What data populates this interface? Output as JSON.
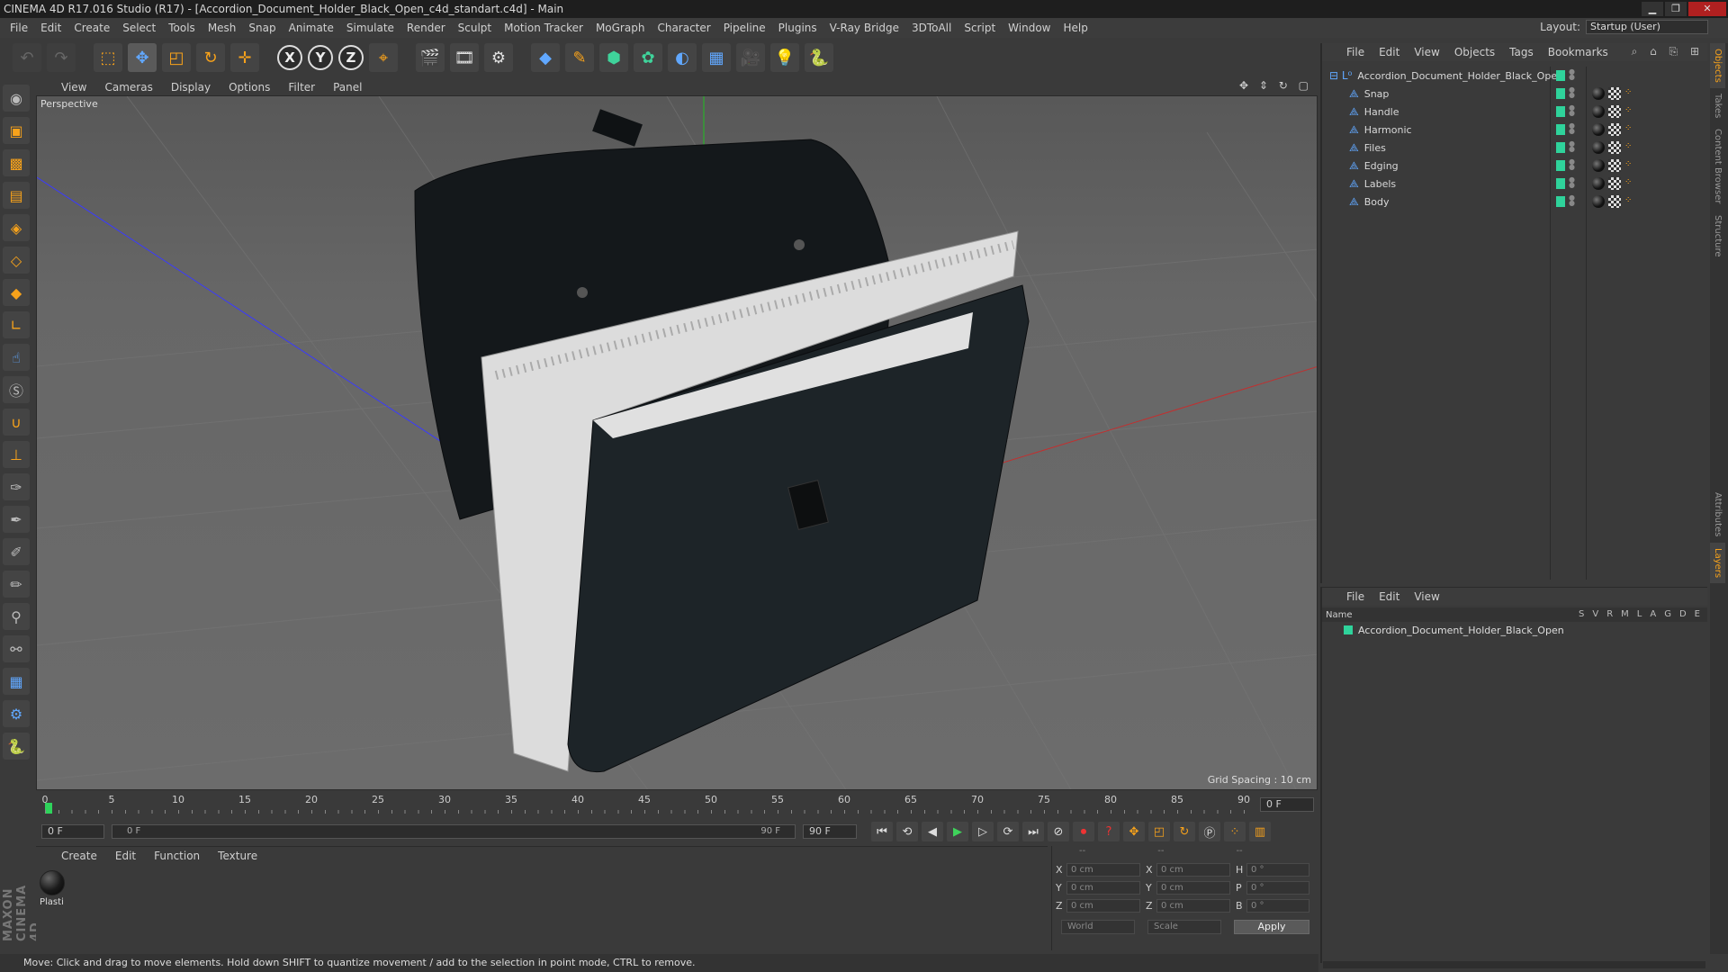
{
  "window": {
    "title": "CINEMA 4D R17.016 Studio (R17) - [Accordion_Document_Holder_Black_Open_c4d_standart.c4d] - Main",
    "minimize": "▁",
    "maximize": "❐",
    "close": "✕"
  },
  "menu": [
    "File",
    "Edit",
    "Create",
    "Select",
    "Tools",
    "Mesh",
    "Snap",
    "Animate",
    "Simulate",
    "Render",
    "Sculpt",
    "Motion Tracker",
    "MoGraph",
    "Character",
    "Pipeline",
    "Plugins",
    "V-Ray Bridge",
    "3DToAll",
    "Script",
    "Window",
    "Help"
  ],
  "layout": {
    "label": "Layout:",
    "value": "Startup (User)"
  },
  "viewport": {
    "menu": [
      "View",
      "Cameras",
      "Display",
      "Options",
      "Filter",
      "Panel"
    ],
    "label": "Perspective",
    "grid_spacing": "Grid Spacing : 10 cm",
    "nav_icons": "✥ ⇕ ↻ ▢"
  },
  "timeline": {
    "ticks": [
      "0",
      "5",
      "10",
      "15",
      "20",
      "25",
      "30",
      "35",
      "40",
      "45",
      "50",
      "55",
      "60",
      "65",
      "70",
      "75",
      "80",
      "85",
      "90"
    ],
    "current_frame": "0 F",
    "start_field": "0 F",
    "slider_start": "0 F",
    "slider_end": "90 F",
    "end_field": "90 F"
  },
  "materials": {
    "menu": [
      "Create",
      "Edit",
      "Function",
      "Texture"
    ],
    "items": [
      {
        "name": "Plasti"
      }
    ]
  },
  "coords": {
    "headers": [
      "--",
      "--",
      "--"
    ],
    "rows": [
      {
        "a": "X",
        "av": "0 cm",
        "b": "X",
        "bv": "0 cm",
        "c": "H",
        "cv": "0 °"
      },
      {
        "a": "Y",
        "av": "0 cm",
        "b": "Y",
        "bv": "0 cm",
        "c": "P",
        "cv": "0 °"
      },
      {
        "a": "Z",
        "av": "0 cm",
        "b": "Z",
        "bv": "0 cm",
        "c": "B",
        "cv": "0 °"
      }
    ],
    "space": "World",
    "mode": "Scale",
    "apply": "Apply"
  },
  "status": "Move: Click and drag to move elements. Hold down SHIFT to quantize movement / add to the selection in point mode, CTRL to remove.",
  "objects": {
    "menu": [
      "File",
      "Edit",
      "View",
      "Objects",
      "Tags",
      "Bookmarks"
    ],
    "root": "Accordion_Document_Holder_Black_Open",
    "children": [
      "Snap",
      "Handle",
      "Harmonic",
      "Files",
      "Edging",
      "Labels",
      "Body"
    ],
    "tools": "⌕ ⌂ ⎘ ⊞",
    "visible_color": "#2fd39b"
  },
  "layers": {
    "menu": [
      "File",
      "Edit",
      "View"
    ],
    "name_header": "Name",
    "columns": [
      "S",
      "V",
      "R",
      "M",
      "L",
      "A",
      "G",
      "D",
      "E"
    ],
    "rows": [
      "Accordion_Document_Holder_Black_Open"
    ]
  },
  "side_tabs": [
    "Objects",
    "Takes",
    "Content Browser",
    "Structure",
    "Attributes",
    "Layers"
  ],
  "maxon_logo": "MAXON CINEMA 4D",
  "colors": {
    "accent": "#f7a21b",
    "green": "#2fd39b",
    "blue": "#61a8ff"
  }
}
